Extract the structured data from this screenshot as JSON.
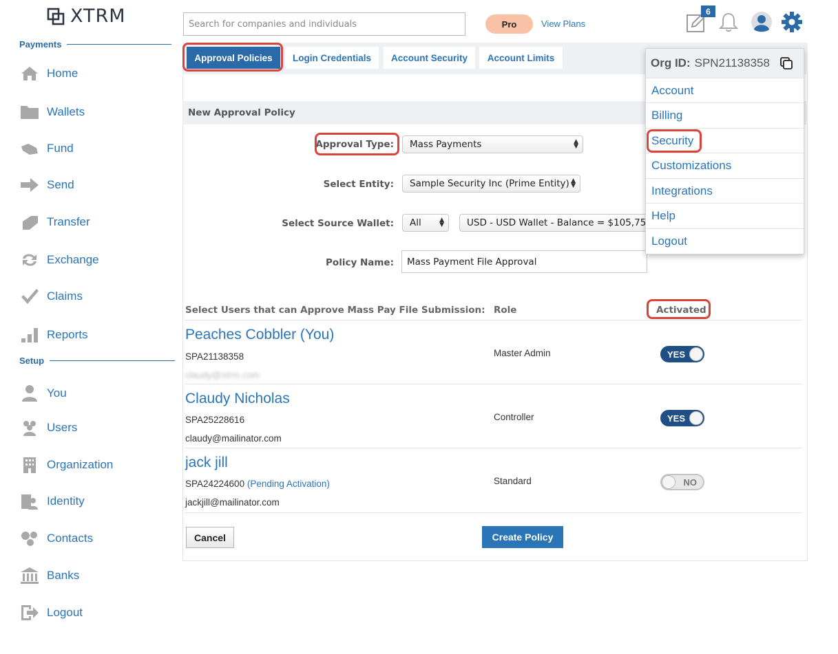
{
  "app": {
    "logo_text": "XTRM"
  },
  "sidebar": {
    "payments_heading": "Payments",
    "setup_heading": "Setup",
    "payments_items": [
      {
        "label": "Home",
        "icon": "home-icon"
      },
      {
        "label": "Wallets",
        "icon": "folder-icon"
      },
      {
        "label": "Fund",
        "icon": "fund-icon"
      },
      {
        "label": "Send",
        "icon": "send-arrow-icon"
      },
      {
        "label": "Transfer",
        "icon": "transfer-icon"
      },
      {
        "label": "Exchange",
        "icon": "exchange-icon"
      },
      {
        "label": "Claims",
        "icon": "checkmark-icon"
      },
      {
        "label": "Reports",
        "icon": "bar-chart-icon"
      }
    ],
    "setup_items": [
      {
        "label": "You",
        "icon": "person-icon"
      },
      {
        "label": "Users",
        "icon": "users-icon"
      },
      {
        "label": "Organization",
        "icon": "building-icon"
      },
      {
        "label": "Identity",
        "icon": "identity-icon"
      },
      {
        "label": "Contacts",
        "icon": "contacts-icon"
      },
      {
        "label": "Banks",
        "icon": "bank-icon"
      },
      {
        "label": "Logout",
        "icon": "logout-icon"
      }
    ]
  },
  "header": {
    "search_placeholder": "Search for companies and individuals",
    "plan_badge": "Pro",
    "view_plans": "View Plans",
    "notes_count": "6"
  },
  "tabs": [
    {
      "label": "Approval Policies",
      "active": true
    },
    {
      "label": "Login Credentials",
      "active": false
    },
    {
      "label": "Account Security",
      "active": false
    },
    {
      "label": "Account Limits",
      "active": false
    }
  ],
  "form": {
    "section_title": "New Approval Policy",
    "approval_type_label": "Approval Type:",
    "approval_type_value": "Mass Payments",
    "entity_label": "Select Entity:",
    "entity_value": "Sample Security Inc (Prime Entity)",
    "source_wallet_label": "Select Source Wallet:",
    "source_wallet_filter": "All",
    "source_wallet_value": "USD - USD Wallet - Balance = $105,75",
    "policy_name_label": "Policy Name:",
    "policy_name_value": "Mass Payment File Approval"
  },
  "users_table": {
    "col_users": "Select Users that can Approve Mass Pay File Submission:",
    "col_role": "Role",
    "col_activated": "Activated",
    "rows": [
      {
        "name": "Peaches Cobbler (You)",
        "id": "SPA21138358",
        "pending": "",
        "email": "claudy@xtrm.com",
        "role": "Master Admin",
        "activated": "YES"
      },
      {
        "name": "Claudy Nicholas",
        "id": "SPA25228616",
        "pending": "",
        "email": "claudy@mailinator.com",
        "role": "Controller",
        "activated": "YES"
      },
      {
        "name": "jack jill",
        "id": "SPA24224600",
        "pending": "(Pending Activation)",
        "email": "jackjill@mailinator.com",
        "role": "Standard",
        "activated": "NO"
      }
    ]
  },
  "buttons": {
    "cancel": "Cancel",
    "create": "Create Policy"
  },
  "menu": {
    "org_id_label": "Org ID:",
    "org_id_value": "SPN21138358",
    "items": [
      "Account",
      "Billing",
      "Security",
      "Customizations",
      "Integrations",
      "Help",
      "Logout"
    ]
  },
  "colors": {
    "accent": "#2a74b8",
    "highlight": "#d9443a",
    "pro_badge": "#f9c1a6"
  }
}
